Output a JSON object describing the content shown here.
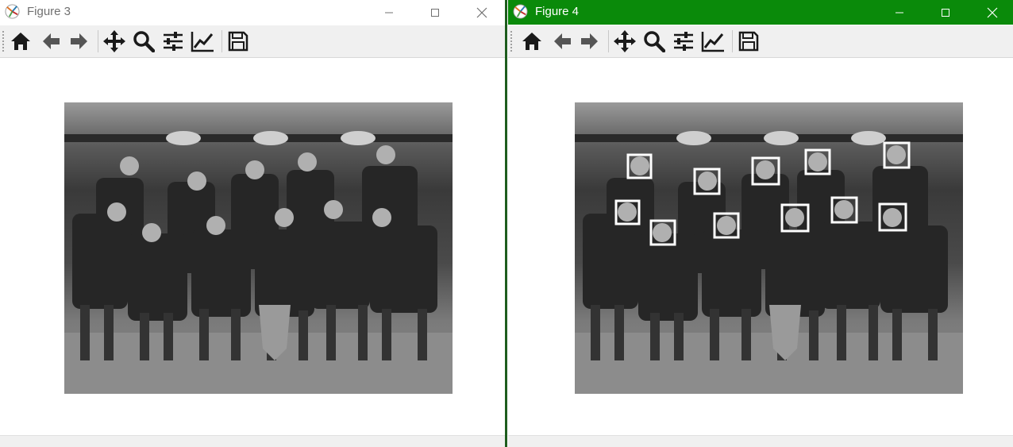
{
  "windows": [
    {
      "id": "win3",
      "title": "Figure 3",
      "active": false,
      "titlebar_color": "#ffffff",
      "image_desc": "grayscale-team-photo",
      "face_boxes_drawn": false
    },
    {
      "id": "win4",
      "title": "Figure 4",
      "active": true,
      "titlebar_color": "#0a8a0a",
      "image_desc": "grayscale-team-photo-with-face-detections",
      "face_boxes_drawn": true,
      "detected_faces_count": 11
    }
  ],
  "window_buttons": [
    "minimize-icon",
    "maximize-icon",
    "close-icon"
  ],
  "toolbar_buttons": [
    {
      "name": "home-button",
      "icon": "home-icon"
    },
    {
      "name": "back-button",
      "icon": "arrow-left-icon"
    },
    {
      "name": "forward-button",
      "icon": "arrow-right-icon"
    },
    {
      "name": "pan-button",
      "icon": "move-icon"
    },
    {
      "name": "zoom-button",
      "icon": "zoom-icon"
    },
    {
      "name": "configure-subplots-button",
      "icon": "sliders-icon"
    },
    {
      "name": "edit-axis-button",
      "icon": "line-chart-icon"
    },
    {
      "name": "save-button",
      "icon": "save-icon"
    }
  ]
}
